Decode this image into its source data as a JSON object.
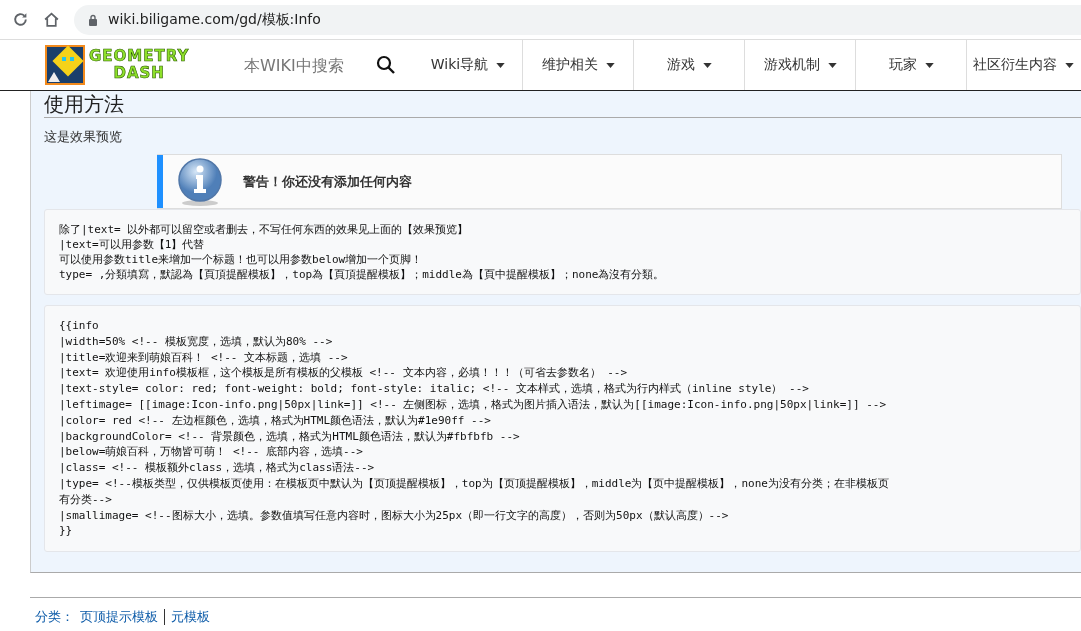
{
  "browser": {
    "url": "wiki.biligame.com/gd/模板:Info"
  },
  "site": {
    "logo_lines": [
      "GEOMETRY",
      "DASH"
    ],
    "search": {
      "placeholder": "本WIKI中搜索"
    },
    "nav": [
      {
        "label": "Wiki导航"
      },
      {
        "label": "维护相关"
      },
      {
        "label": "游戏"
      },
      {
        "label": "游戏机制"
      },
      {
        "label": "玩家"
      },
      {
        "label": "社区衍生内容"
      }
    ]
  },
  "content": {
    "heading": "使用方法",
    "preview_label": "这是效果预览",
    "notice": {
      "text": "警告！你还没有添加任何内容",
      "color": "#1e90ff"
    },
    "notes": [
      "除了|text= 以外都可以留空或者删去，不写任何东西的效果见上面的【效果预览】",
      "|text=可以用参数【1】代替",
      "可以使用参数title来增加一个标题！也可以用参数below增加一个页脚！",
      "type= ,分類填寫，默認為【頁頂提醒模板】，top為【頁頂提醒模板】；middle為【頁中提醒模板】；none為沒有分類。"
    ],
    "code_lines": [
      "{{info",
      "|width=50% <!-- 模板宽度，选填，默认为80% -->",
      "|title=欢迎来到萌娘百科！ <!-- 文本标题，选填 -->",
      "|text= 欢迎使用info模板框，这个模板是所有模板的父模板 <!-- 文本内容，必填！！！（可省去参数名） -->",
      "|text-style= color: red; font-weight: bold; font-style: italic; <!-- 文本样式，选填，格式为行内样式（inline style） -->",
      "|leftimage= [[image:Icon-info.png|50px|link=]] <!-- 左侧图标，选填，格式为图片插入语法，默认为[[image:Icon-info.png|50px|link=]] -->",
      "|color= red <!-- 左边框颜色，选填，格式为HTML颜色语法，默认为#1e90ff -->",
      "|backgroundColor= <!-- 背景颜色，选填，格式为HTML颜色语法，默认为#fbfbfb -->",
      "|below=萌娘百科，万物皆可萌！ <!-- 底部内容，选填-->",
      "|class= <!-- 模板额外class，选填，格式为class语法-->",
      "|type= <!--模板类型，仅供模板页使用：在模板页中默认为【页顶提醒模板】，top为【页顶提醒模板】，middle为【页中提醒模板】，none为没有分类；在非模板页",
      "有分类-->",
      "|smallimage= <!--图标大小，选填。参数值填写任意内容时，图标大小为25px（即一行文字的高度），否则为50px（默认高度）-->",
      "}}"
    ]
  },
  "categories": {
    "label": "分类：",
    "links": [
      "页顶提示模板",
      "元模板"
    ]
  }
}
